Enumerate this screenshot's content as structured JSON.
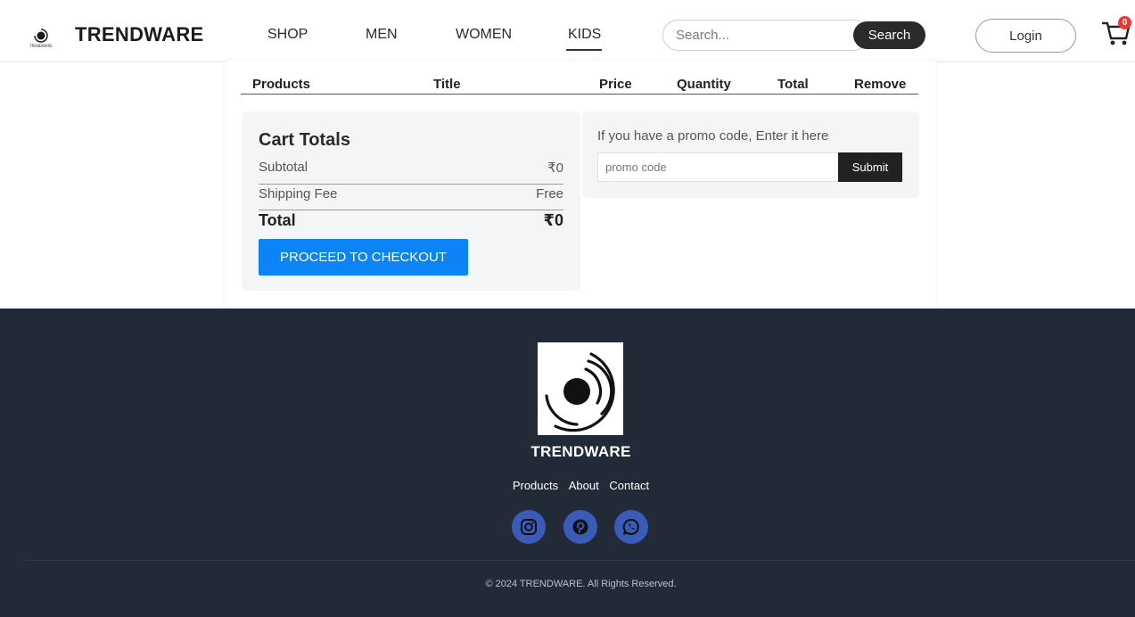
{
  "brand": {
    "name": "TRENDWARE",
    "logo_icon": "trendware-logo-icon",
    "logo_text": "TRENDWARE"
  },
  "nav": {
    "items": [
      {
        "label": "SHOP",
        "active": false
      },
      {
        "label": "MEN",
        "active": false
      },
      {
        "label": "WOMEN",
        "active": false
      },
      {
        "label": "KIDS",
        "active": true
      }
    ]
  },
  "search": {
    "placeholder": "Search...",
    "value": "",
    "button_label": "Search"
  },
  "login": {
    "label": "Login"
  },
  "cart": {
    "icon": "shopping-cart-icon",
    "badge_count": "0"
  },
  "cart_table": {
    "headers": [
      "Products",
      "Title",
      "Price",
      "Quantity",
      "Total",
      "Remove"
    ],
    "rows": []
  },
  "cart_totals": {
    "title": "Cart Totals",
    "subtotal_label": "Subtotal",
    "subtotal_value": "₹0",
    "shipping_label": "Shipping Fee",
    "shipping_value": "Free",
    "total_label": "Total",
    "total_value": "₹0",
    "checkout_label": "PROCEED TO CHECKOUT"
  },
  "promo": {
    "text": "If you have a promo code, Enter it here",
    "placeholder": "promo code",
    "value": "",
    "submit_label": "Submit"
  },
  "footer": {
    "brand": "TRENDWARE",
    "links": [
      "Products",
      "About",
      "Contact"
    ],
    "social_icons": [
      "instagram-icon",
      "pinterest-icon",
      "whatsapp-icon"
    ],
    "copyright": "© 2024 TRENDWARE. All Rights Reserved."
  },
  "colors": {
    "footer_bg": "#222a38",
    "checkout_button": "#0d84f5",
    "social_bg": "#3a5bb8",
    "badge": "#e53935",
    "dark_button": "#2a2a2a"
  }
}
